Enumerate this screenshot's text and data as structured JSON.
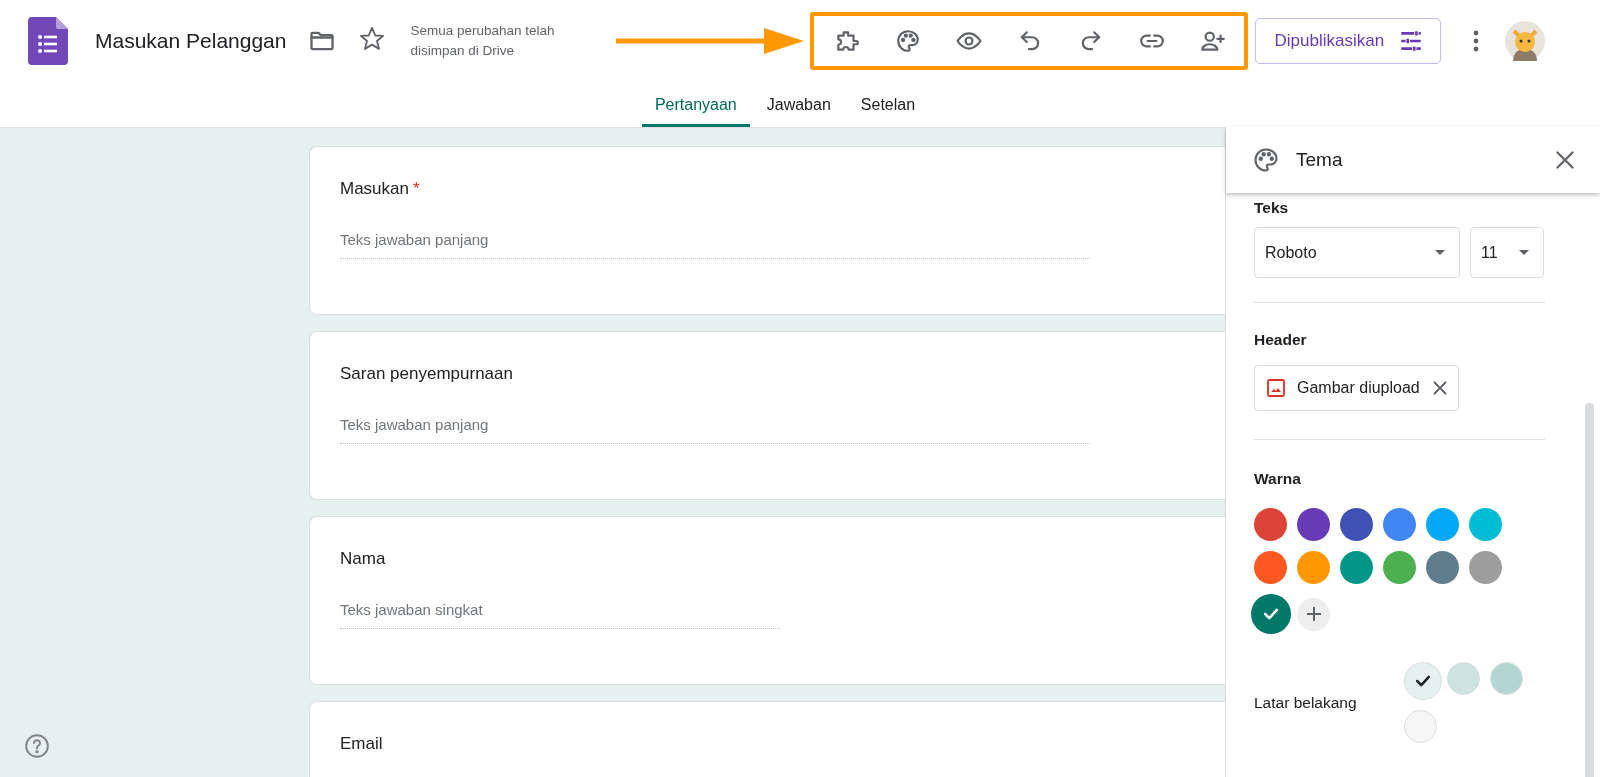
{
  "header": {
    "title": "Masukan Pelanggan",
    "save_status": "Semua perubahan telah disimpan di Drive",
    "publish_button": "Dipublikasikan"
  },
  "tabs": [
    {
      "label": "Pertanyaan",
      "selected": true
    },
    {
      "label": "Jawaban",
      "selected": false
    },
    {
      "label": "Setelan",
      "selected": false
    }
  ],
  "questions": [
    {
      "title": "Masukan",
      "required_mark": "*",
      "placeholder": "Teks jawaban panjang",
      "kind": "long"
    },
    {
      "title": "Saran penyempurnaan",
      "placeholder": "Teks jawaban panjang",
      "kind": "long"
    },
    {
      "title": "Nama",
      "placeholder": "Teks jawaban singkat",
      "kind": "short"
    },
    {
      "title": "Email",
      "kind": "cut"
    }
  ],
  "theme_panel": {
    "title": "Tema",
    "text_section": {
      "label": "Teks",
      "font": "Roboto",
      "size": "11"
    },
    "header_section": {
      "label": "Header",
      "image_chip": "Gambar diupload"
    },
    "color_section": {
      "label": "Warna",
      "colors": [
        {
          "color": "#db4437",
          "selected": false
        },
        {
          "color": "#673ab7",
          "selected": false
        },
        {
          "color": "#3f51b5",
          "selected": false
        },
        {
          "color": "#4285f4",
          "selected": false
        },
        {
          "color": "#03a9f4",
          "selected": false
        },
        {
          "color": "#00bcd4",
          "selected": false
        },
        {
          "color": "#ff5722",
          "selected": false
        },
        {
          "color": "#ff9800",
          "selected": false
        },
        {
          "color": "#009688",
          "selected": false
        },
        {
          "color": "#4caf50",
          "selected": false
        },
        {
          "color": "#607d8b",
          "selected": false
        },
        {
          "color": "#9e9e9e",
          "selected": false
        },
        {
          "color": "#00796b",
          "selected": true
        }
      ]
    },
    "background_section": {
      "label": "Latar belakang",
      "colors": [
        {
          "color": "#e6f0ee",
          "selected": true
        },
        {
          "color": "#cde3e0",
          "selected": false
        },
        {
          "color": "#b3d6d3",
          "selected": false
        },
        {
          "color": "#f6f6f6",
          "selected": false
        }
      ]
    }
  }
}
